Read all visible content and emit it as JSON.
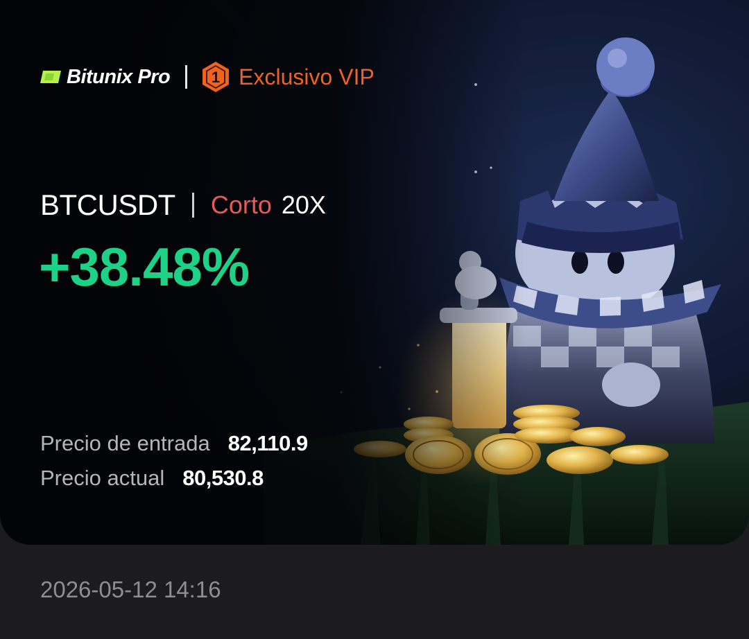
{
  "brand": {
    "name": "Bitunix Pro",
    "logo_icon": "bitunix-logo-icon",
    "vip_rank": "1",
    "vip_label": "Exclusivo VIP",
    "vip_icon": "hexagon-badge-icon"
  },
  "position": {
    "pair": "BTCUSDT",
    "side": "Corto",
    "leverage": "20X",
    "pnl_percent": "+38.48%"
  },
  "prices": {
    "entry_label": "Precio de entrada",
    "entry_value": "82,110.9",
    "current_label": "Precio actual",
    "current_value": "80,530.8"
  },
  "timestamp": "2026-05-12 14:16",
  "illustration": {
    "name": "chess-pawn-knight-with-sword-and-coins-illustration"
  },
  "colors": {
    "background": "#1c1c1e",
    "card": "#05070d",
    "profit_green": "#1dd187",
    "short_red": "#e85a5a",
    "vip_orange": "#f0631e",
    "brand_green": "#b6f04a"
  }
}
